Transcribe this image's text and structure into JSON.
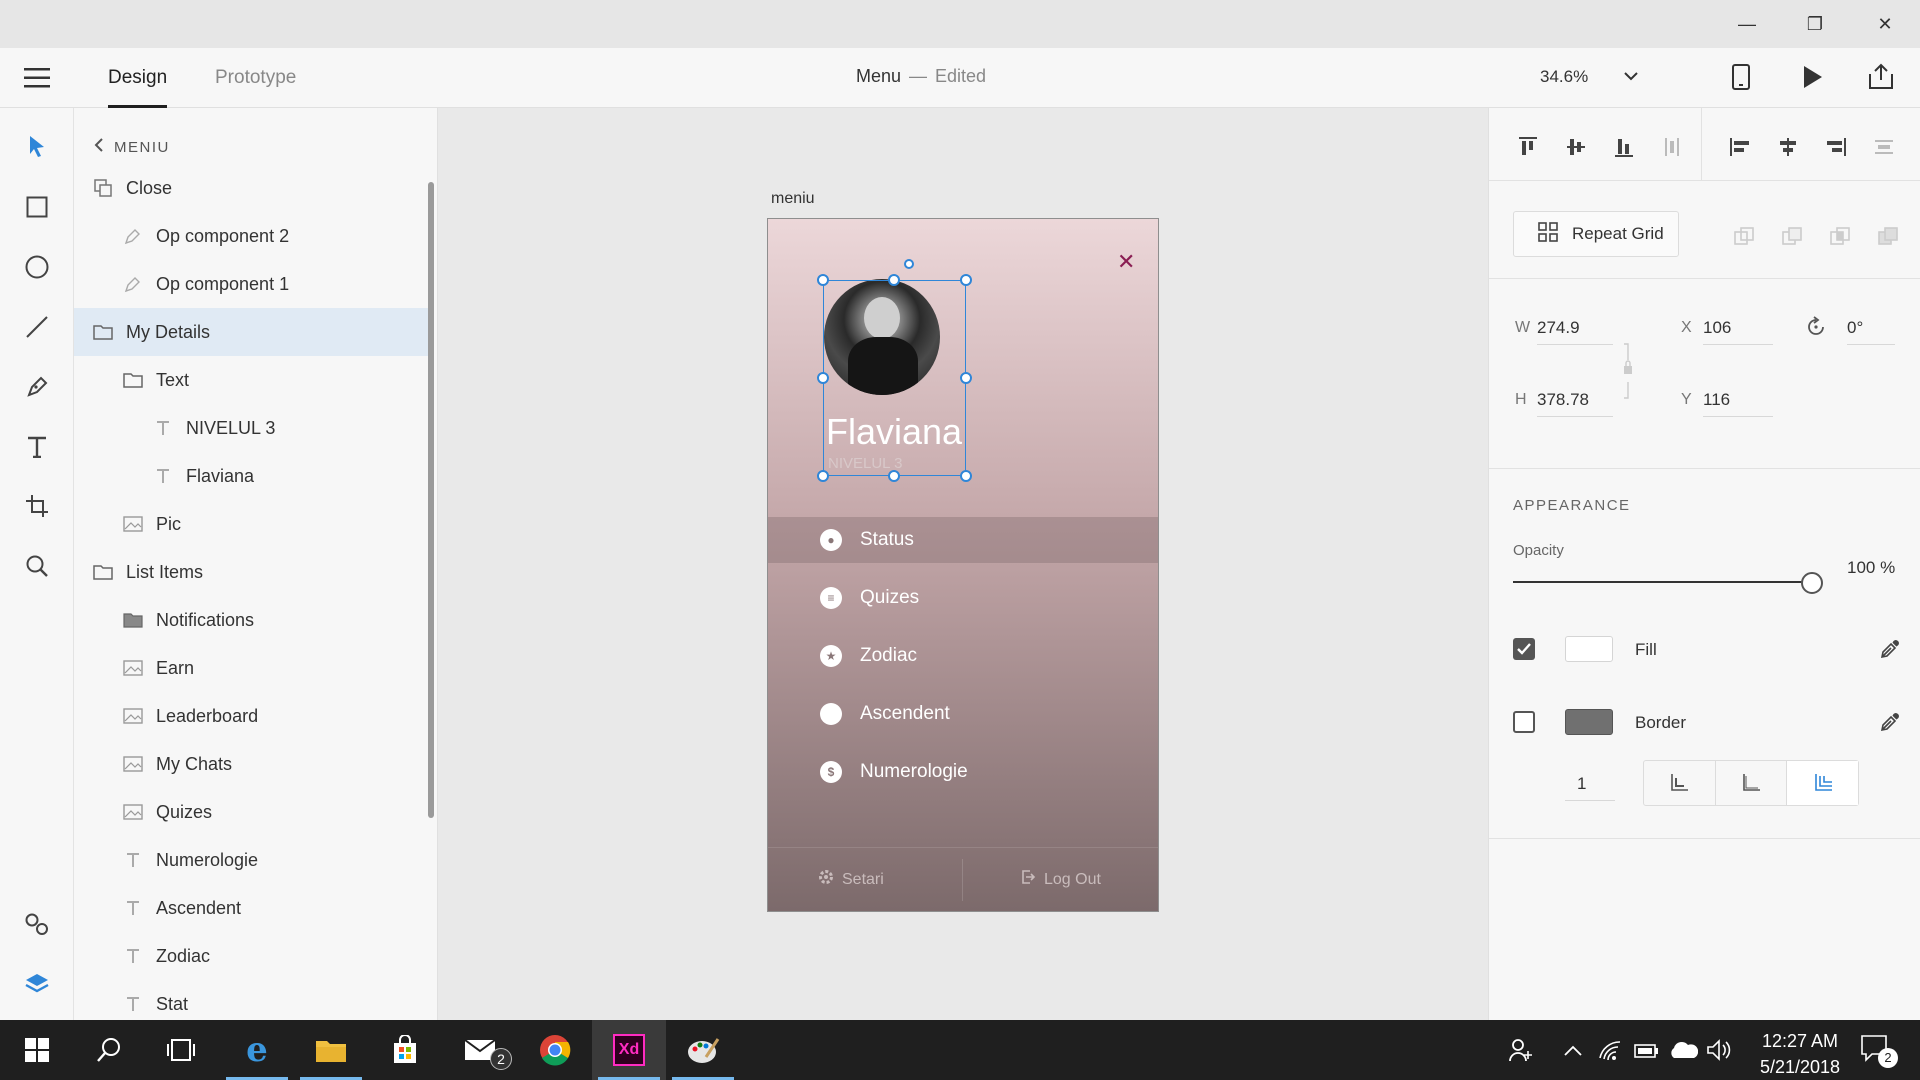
{
  "colors": {
    "accent": "#2f86d8",
    "close_x": "#8a1e53",
    "xd_brand": "#ff2bc2"
  },
  "window": {
    "minimize": "—",
    "maximize": "❐",
    "close": "✕"
  },
  "header": {
    "tabs": [
      {
        "label": "Design"
      },
      {
        "label": "Prototype"
      }
    ],
    "doc_title": "Menu",
    "doc_sep": "—",
    "doc_status": "Edited",
    "zoom": "34.6%"
  },
  "layers": {
    "back_label": "MENIU",
    "items": [
      {
        "label": "Close",
        "icon": "component-icon"
      },
      {
        "label": "Op component 2",
        "icon": "pen-icon"
      },
      {
        "label": "Op component 1",
        "icon": "pen-icon"
      },
      {
        "label": "My Details",
        "icon": "folder-icon",
        "selected": true
      },
      {
        "label": "Text",
        "icon": "folder-icon"
      },
      {
        "label": "NIVELUL 3",
        "icon": "text-icon"
      },
      {
        "label": "Flaviana",
        "icon": "text-icon"
      },
      {
        "label": "Pic",
        "icon": "image-icon"
      },
      {
        "label": "List Items",
        "icon": "folder-icon"
      },
      {
        "label": "Notifications",
        "icon": "folder-filled-icon"
      },
      {
        "label": "Earn",
        "icon": "image-icon"
      },
      {
        "label": "Leaderboard",
        "icon": "image-icon"
      },
      {
        "label": "My Chats",
        "icon": "image-icon"
      },
      {
        "label": "Quizes",
        "icon": "image-icon"
      },
      {
        "label": "Numerologie",
        "icon": "text-icon"
      },
      {
        "label": "Ascendent",
        "icon": "text-icon"
      },
      {
        "label": "Zodiac",
        "icon": "text-icon"
      },
      {
        "label": "Stat",
        "icon": "text-icon"
      }
    ]
  },
  "artboard": {
    "label": "meniu",
    "name": "Flaviana",
    "level": "NIVELUL 3",
    "close_glyph": "✕",
    "menu": [
      {
        "label": "Status",
        "icon": "radio-icon",
        "glyph": "●"
      },
      {
        "label": "Quizes",
        "icon": "list-icon",
        "glyph": "≡"
      },
      {
        "label": "Zodiac",
        "icon": "star-icon",
        "glyph": "★"
      },
      {
        "label": "Ascendent",
        "icon": "circle-icon",
        "glyph": ""
      },
      {
        "label": "Numerologie",
        "icon": "dollar-icon",
        "glyph": "$"
      }
    ],
    "settings": "Setari",
    "logout": "Log Out"
  },
  "props": {
    "repeat_grid": "Repeat Grid",
    "w_label": "W",
    "w": "274.9",
    "h_label": "H",
    "h": "378.78",
    "x_label": "X",
    "x": "106",
    "y_label": "Y",
    "y": "116",
    "rotation": "0°",
    "appearance": "APPEARANCE",
    "opacity_label": "Opacity",
    "opacity": "100 %",
    "opacity_fraction": 1.0,
    "fill_label": "Fill",
    "fill_color": "#ffffff",
    "fill_checked": true,
    "border_label": "Border",
    "border_color": "#707070",
    "border_checked": false,
    "border_width": "1"
  },
  "taskbar": {
    "time": "12:27 AM",
    "date": "5/21/2018",
    "mail_badge": "2",
    "notif_badge": "2",
    "xd_label": "Xd"
  }
}
